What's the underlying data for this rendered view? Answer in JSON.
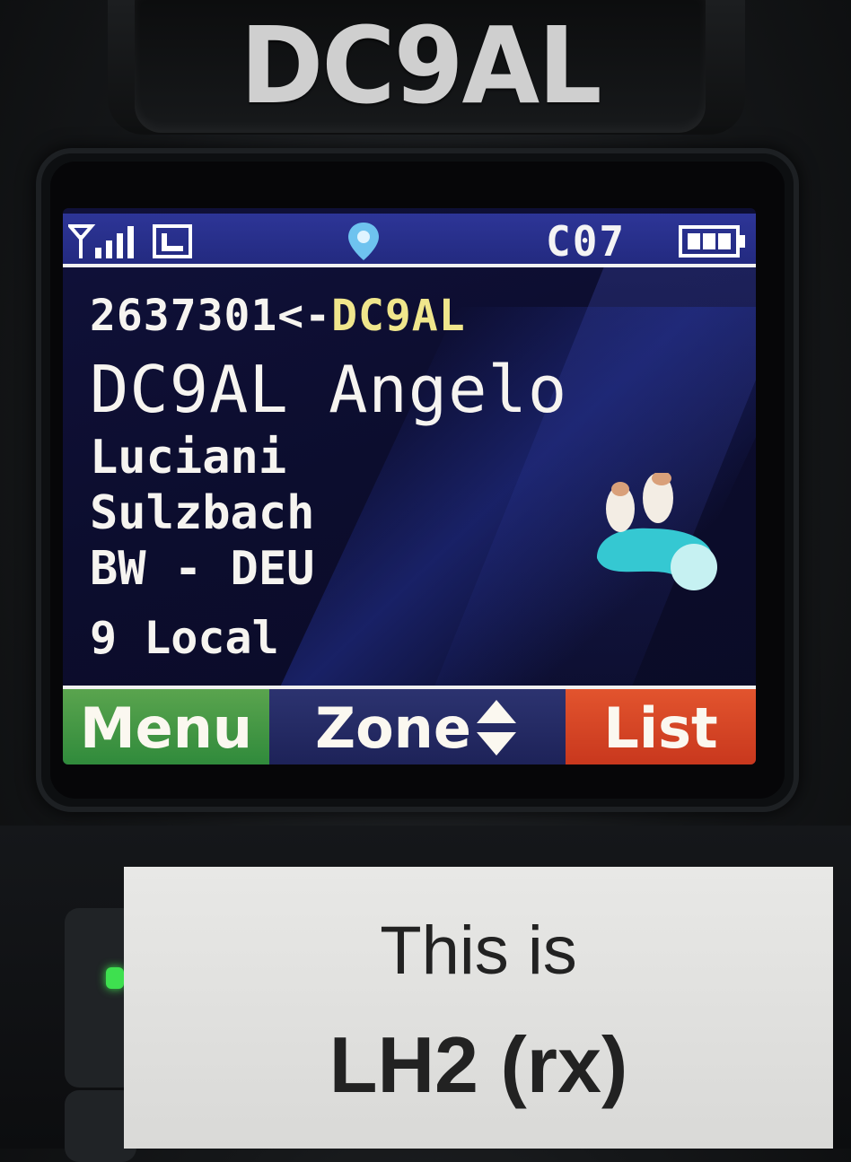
{
  "device": {
    "callsign_label": "DC9AL"
  },
  "status_bar": {
    "signal_icon": "signal-bars-icon",
    "message_icon": "sms-icon",
    "gps_icon": "gps-pin-icon",
    "channel": "C07",
    "battery_icon": "battery-icon"
  },
  "call_info": {
    "id_prefix": "2637301<-",
    "id_callsign": "DC9AL",
    "name_line": "DC9AL Angelo",
    "last_name": "Luciani",
    "city": "Sulzbach",
    "region": "BW - DEU",
    "talkgroup": "9 Local"
  },
  "softkeys": {
    "left": "Menu",
    "center": "Zone",
    "right": "List"
  },
  "sticker": {
    "line1": "This is",
    "line2": "LH2 (rx)"
  },
  "colors": {
    "status_bar": "#2d3597",
    "id_callsign": "#f0e68c",
    "menu_key": "#3f9a45",
    "list_key": "#d8452a",
    "screen_bg": "#0c0d2e"
  }
}
